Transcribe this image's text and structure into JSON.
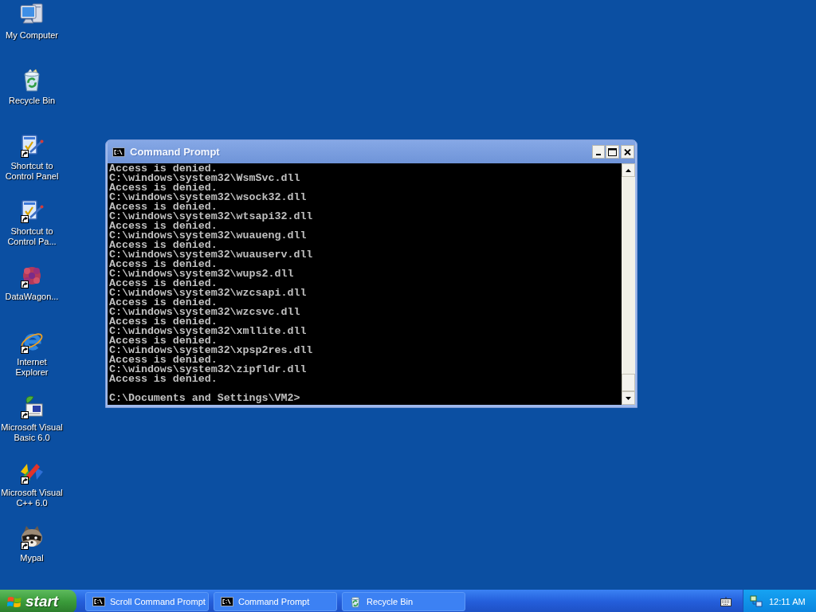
{
  "desktop_icons": [
    {
      "label": "My Computer",
      "kind": "computer",
      "shortcut": false
    },
    {
      "label": "Recycle Bin",
      "kind": "bin",
      "shortcut": false
    },
    {
      "label": "Shortcut to Control Panel",
      "kind": "panel",
      "shortcut": true
    },
    {
      "label": "Shortcut to Control Pa...",
      "kind": "panel",
      "shortcut": true
    },
    {
      "label": "DataWagon...",
      "kind": "flower",
      "shortcut": true
    },
    {
      "label": "Internet Explorer",
      "kind": "browser",
      "shortcut": true
    },
    {
      "label": "Microsoft Visual Basic 6.0",
      "kind": "basic",
      "shortcut": true
    },
    {
      "label": "Microsoft Visual C++ 6.0",
      "kind": "cpp",
      "shortcut": true
    },
    {
      "label": "Mypal",
      "kind": "raccoon",
      "shortcut": true
    }
  ],
  "window": {
    "title": "Command Prompt",
    "focused": false,
    "lines": [
      "Access is denied.",
      "C:\\windows\\system32\\WsmSvc.dll",
      "Access is denied.",
      "C:\\windows\\system32\\wsock32.dll",
      "Access is denied.",
      "C:\\windows\\system32\\wtsapi32.dll",
      "Access is denied.",
      "C:\\windows\\system32\\wuaueng.dll",
      "Access is denied.",
      "C:\\windows\\system32\\wuauserv.dll",
      "Access is denied.",
      "C:\\windows\\system32\\wups2.dll",
      "Access is denied.",
      "C:\\windows\\system32\\wzcsapi.dll",
      "Access is denied.",
      "C:\\windows\\system32\\wzcsvc.dll",
      "Access is denied.",
      "C:\\windows\\system32\\xmllite.dll",
      "Access is denied.",
      "C:\\windows\\system32\\xpsp2res.dll",
      "Access is denied.",
      "C:\\windows\\system32\\zipfldr.dll",
      "Access is denied."
    ],
    "prompt": "C:\\Documents and Settings\\VM2>"
  },
  "taskbar": {
    "start": "start",
    "buttons": [
      {
        "label": "Scroll Command Prompt",
        "kind": "console",
        "selected": false
      },
      {
        "label": "Command Prompt",
        "kind": "console",
        "selected": false
      },
      {
        "label": "Recycle Bin",
        "kind": "bin",
        "selected": false
      }
    ],
    "clock": "12:11 AM"
  }
}
